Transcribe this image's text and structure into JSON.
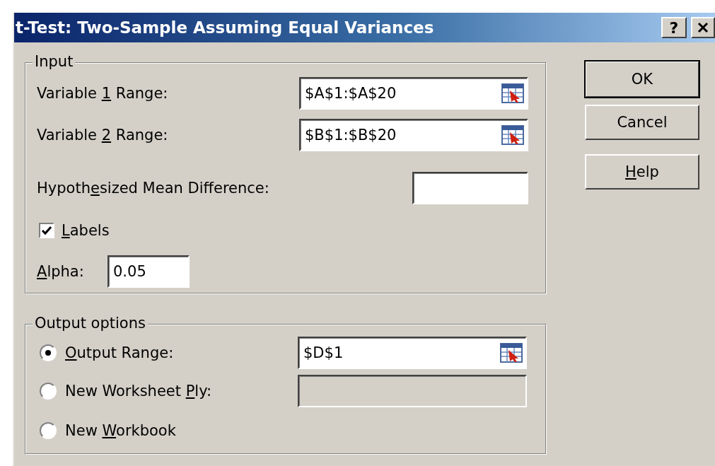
{
  "window": {
    "title": "t-Test: Two-Sample Assuming Equal Variances",
    "help_button": "?"
  },
  "input_group": {
    "legend": "Input",
    "range_fields": [
      {
        "label": {
          "before": "Variable ",
          "key": "1",
          "after": " Range:"
        },
        "value": "$A$1:$A$20"
      },
      {
        "label": {
          "before": "Variable ",
          "key": "2",
          "after": " Range:"
        },
        "value": "$B$1:$B$20"
      }
    ],
    "hypothesized": {
      "label": {
        "before": "Hypoth",
        "key": "e",
        "after": "sized Mean Difference:"
      }
    },
    "labels_checkbox": {
      "label": {
        "key": "L",
        "after": "abels"
      },
      "checked": true
    },
    "alpha": {
      "label": {
        "key": "A",
        "after": "lpha:"
      },
      "value": "0.05"
    }
  },
  "output_group": {
    "legend": "Output options",
    "options": [
      {
        "label": {
          "key": "O",
          "after": "utput Range:"
        },
        "selected": true,
        "field": {
          "value": "$D$1",
          "disabled": false
        }
      },
      {
        "label": {
          "before": "New Worksheet ",
          "key": "P",
          "after": "ly:"
        },
        "selected": false,
        "field": {
          "disabled": true
        }
      },
      {
        "label": {
          "before": "New ",
          "key": "W",
          "after": "orkbook"
        },
        "selected": false
      }
    ]
  },
  "buttons": [
    {
      "label": {
        "before": "OK"
      },
      "default": true
    },
    {
      "label": {
        "before": "Cancel"
      },
      "default": false
    },
    {
      "label": {
        "key": "H",
        "after": "elp"
      },
      "default": false
    }
  ]
}
